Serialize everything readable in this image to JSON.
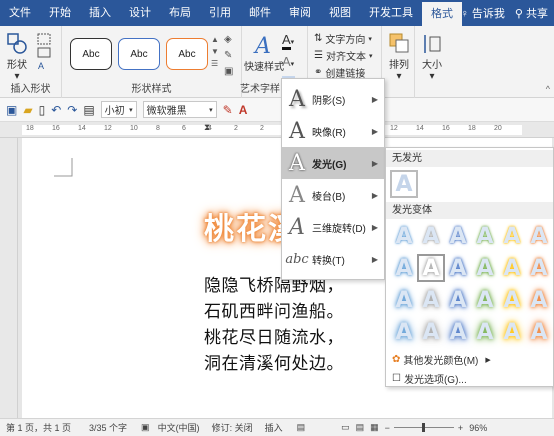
{
  "tabs": [
    "文件",
    "开始",
    "插入",
    "设计",
    "布局",
    "引用",
    "邮件",
    "审阅",
    "视图",
    "开发工具",
    "格式"
  ],
  "active_tab": "格式",
  "tell_me": "告诉我",
  "share": "共享",
  "ribbon": {
    "insert_shape": {
      "shape_label": "形状",
      "group_label": "插入形状"
    },
    "shape_styles": {
      "styles": [
        "Abc",
        "Abc",
        "Abc"
      ],
      "group_label": "形状样式"
    },
    "wordart": {
      "quick_styles_label": "快速样式",
      "group_label": "艺术字样"
    },
    "text": {
      "direction": "文字方向",
      "align": "对齐文本",
      "link": "创建链接"
    },
    "arrange": {
      "label": "排列"
    },
    "size": {
      "label": "大小"
    }
  },
  "qat": {
    "font_size": "小初",
    "font_name": "微软雅黑"
  },
  "ruler_numbers": [
    "18",
    "16",
    "14",
    "12",
    "10",
    "8",
    "6",
    "4",
    "2",
    "2",
    "4",
    "6",
    "8",
    "10",
    "12",
    "14",
    "16",
    "18",
    "20"
  ],
  "document": {
    "title": "桃花溪",
    "lines": [
      "隐隐飞桥隔野烟，",
      "石矶西畔问渔船。",
      "桃花尽日随流水，",
      "洞在清溪何处边。"
    ]
  },
  "effects_menu": {
    "items": [
      {
        "label": "阴影(S)",
        "icon": "shadow-a-icon"
      },
      {
        "label": "映像(R)",
        "icon": "reflection-a-icon"
      },
      {
        "label": "发光(G)",
        "icon": "glow-a-icon",
        "highlighted": true
      },
      {
        "label": "棱台(B)",
        "icon": "bevel-a-icon"
      },
      {
        "label": "三维旋转(D)",
        "icon": "3d-rotation-a-icon"
      },
      {
        "label": "转换(T)",
        "icon": "transform-abc-icon"
      }
    ]
  },
  "glow_menu": {
    "no_glow": "无发光",
    "variants": "发光变体",
    "more_colors": "其他发光颜色(M)",
    "options": "发光选项(G)...",
    "colors": [
      "#5b9bd5",
      "#a5a5a5",
      "#4472c4",
      "#70ad47",
      "#ffc000",
      "#ed7d31"
    ]
  },
  "status": {
    "page": "第 1 页，共 1 页",
    "words": "3/35 个字",
    "lang": "中文(中国)",
    "revision": "修订: 关闭",
    "insert": "插入",
    "zoom": "96%"
  }
}
